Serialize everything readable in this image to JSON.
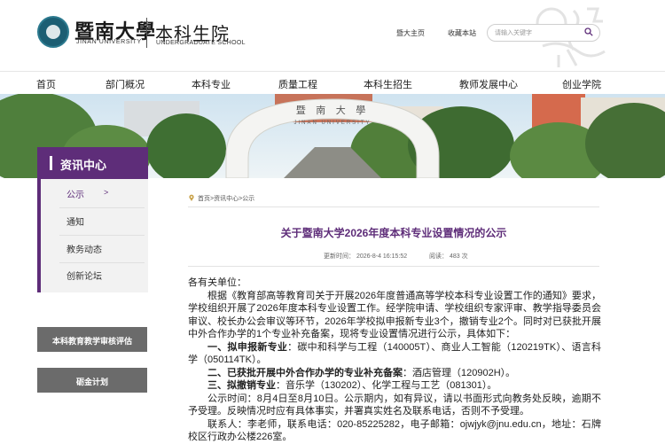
{
  "header": {
    "logo_cn": "暨南大學",
    "logo_en": "JINAN UNIVERSITY",
    "site_title_cn": "本科生院",
    "site_title_en": "UNDERGRADUATE SCHOOL",
    "links": [
      "暨大主页",
      "收藏本站"
    ],
    "search_placeholder": "请输入关键字"
  },
  "nav": {
    "items": [
      "首页",
      "部门概况",
      "本科专业",
      "质量工程",
      "本科生招生",
      "教师发展中心",
      "创业学院"
    ]
  },
  "sidebar": {
    "title": "资讯中心",
    "items": [
      "公示",
      "通知",
      "教务动态",
      "创新论坛"
    ],
    "active_index": 0,
    "active_arrow": ">",
    "buttons": [
      "本科教育教学审核评估",
      "砺金计划"
    ]
  },
  "breadcrumb": {
    "text": "首页>资讯中心>公示"
  },
  "article": {
    "title": "关于暨南大学2026年度本科专业设置情况的公示",
    "update_time": "更新时间： 2026-8-4 16:15:52",
    "views": "阅读： 483 次",
    "greeting": "各有关单位：",
    "para1": "根据《教育部高等教育司关于开展2026年度普通高等学校本科专业设置工作的通知》要求，学校组织开展了2026年度本科专业设置工作。经学院申请、学校组织专家评审、教学指导委员会审议、校长办公会审议等环节，2026年学校拟申报新专业3个，撤销专业2个。同时对已获批开展中外合作办学的1个专业补充备案，现将专业设置情况进行公示，具体如下：",
    "item1_label": "一、拟申报新专业",
    "item1_text": "：碳中和科学与工程（140005T）、商业人工智能（120219TK）、语言科学（050114TK）。",
    "item2_label": "二、已获批开展中外合作办学的专业补充备案",
    "item2_text": "：酒店管理（120902H）。",
    "item3_label": "三、拟撤销专业",
    "item3_text": "：音乐学（130202）、化学工程与工艺（081301）。",
    "para_period": "公示时间：8月4日至8月10日。公示期内，如有异议，请以书面形式向教务处反映，逾期不予受理。反映情况时应有具体事实，并署真实姓名及联系电话，否则不予受理。",
    "para_contact": "联系人：李老师，联系电话：020-85225282，电子邮箱：ojwjyk@jnu.edu.cn，地址：石牌校区行政办公楼226室。"
  },
  "colors": {
    "brand_purple": "#5e2d79",
    "sidebar_button_gray": "#6b6b6b"
  }
}
